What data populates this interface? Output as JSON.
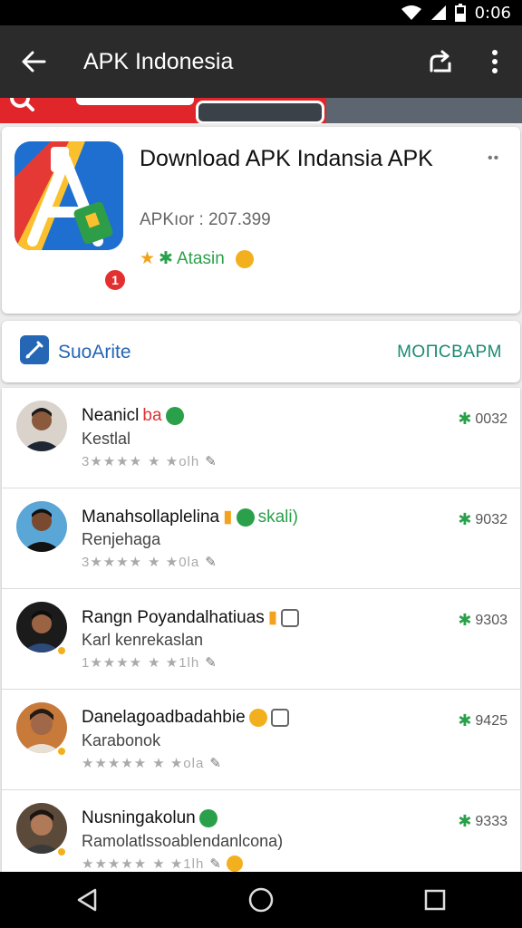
{
  "status_bar": {
    "time": "0:06"
  },
  "app_bar": {
    "title": "APK Indonesia"
  },
  "app_card": {
    "title": "Download APK Indansia APK",
    "badge": "1",
    "size": "APKıor : 207.399",
    "rating_text": "Atasin",
    "more": "••"
  },
  "bar": {
    "left_label": "SuoArite",
    "right_label": "MOΠCBAPM"
  },
  "reviews": [
    {
      "name": "Neanicl",
      "name_extra": "ba",
      "sub": "Kestlal",
      "meta_a": "3★★★★",
      "meta_b": "★ ★olh",
      "score": "0032"
    },
    {
      "name": "Manahsollaplelina",
      "name_extra": "skali)",
      "sub": "Renjehaga",
      "meta_a": "3★★★★",
      "meta_b": "★ ★0la",
      "score": "9032"
    },
    {
      "name": "Rangn Poyandalhatiuas",
      "name_extra": "",
      "sub": "Karl kenrekaslan",
      "meta_a": "1★★★★",
      "meta_b": "★ ★1lh",
      "score": "9303"
    },
    {
      "name": "Danelagoadbadahbie",
      "name_extra": "",
      "sub": "Karabonok",
      "meta_a": "★★★★★",
      "meta_b": "★ ★ola",
      "score": "9425"
    },
    {
      "name": "Nusningakolun",
      "name_extra": "",
      "sub": "Ramolatlssoablendanlcona)",
      "meta_a": "★★★★★",
      "meta_b": "★ ★1lh",
      "score": "9333"
    }
  ],
  "colors": {
    "accent_red": "#e0262a",
    "accent_green": "#2aa04a",
    "link_blue": "#2566b5",
    "appbar": "#2b2b2b"
  }
}
